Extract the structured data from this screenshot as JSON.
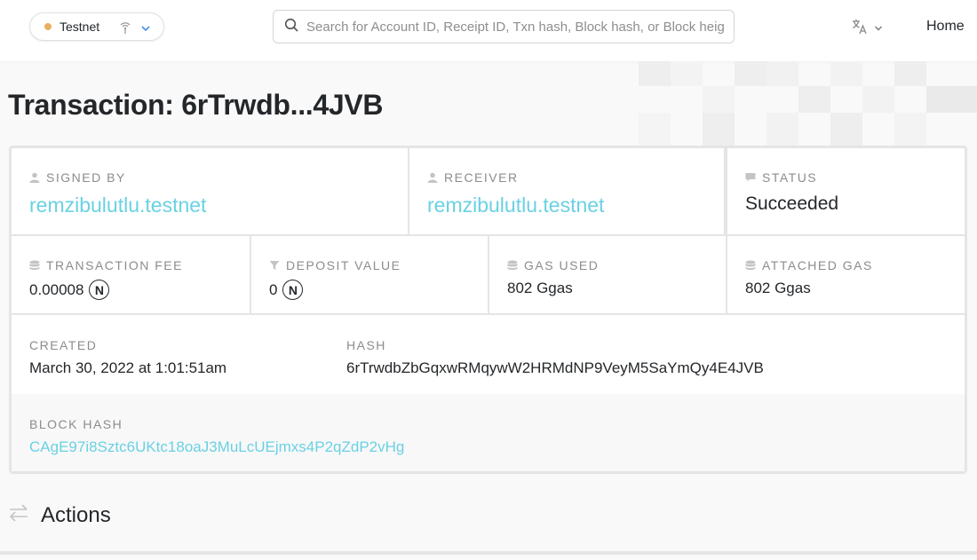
{
  "header": {
    "network": {
      "label": "Testnet",
      "dot_color": "#e8b060"
    },
    "search": {
      "placeholder": "Search for Account ID, Receipt ID, Txn hash, Block hash, or Block height"
    },
    "home_label": "Home"
  },
  "page": {
    "title": "Transaction: 6rTrwdb...4JVB"
  },
  "transaction": {
    "signed_by": {
      "label": "Signed by",
      "value": "remzibulutlu.testnet"
    },
    "receiver": {
      "label": "Receiver",
      "value": "remzibulutlu.testnet"
    },
    "status": {
      "label": "Status",
      "value": "Succeeded"
    },
    "transaction_fee": {
      "label": "Transaction Fee",
      "value": "0.00008",
      "unit_glyph": "N"
    },
    "deposit_value": {
      "label": "Deposit Value",
      "value": "0",
      "unit_glyph": "N"
    },
    "gas_used": {
      "label": "Gas Used",
      "value": "802 Ggas"
    },
    "attached_gas": {
      "label": "Attached Gas",
      "value": "802 Ggas"
    },
    "created": {
      "label": "Created",
      "value": "March 30, 2022 at 1:01:51am"
    },
    "hash": {
      "label": "Hash",
      "value": "6rTrwdbZbGqxwRMqywW2HRMdNP9VeyM5SaYmQy4E4JVB"
    },
    "block_hash": {
      "label": "Block Hash",
      "value": "CAgE97i8Sztc6UKtc18oaJ3MuLcUEjmxs4P2qZdP2vHg"
    }
  },
  "actions": {
    "title": "Actions"
  },
  "colors": {
    "link": "#6ad1e3",
    "text": "#24272a",
    "label": "#8c8c8c"
  }
}
